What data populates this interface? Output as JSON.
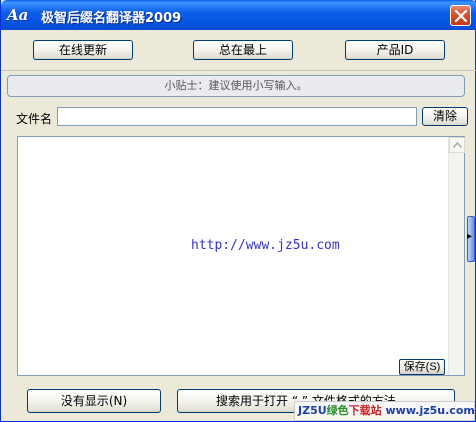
{
  "window": {
    "logo": "Aa",
    "title": "极智后缀名翻译器2009",
    "close_label": "close"
  },
  "toolbar": {
    "online_update": "在线更新",
    "always_on_top": "总在最上",
    "product_id": "产品ID"
  },
  "tip": "小贴士：建议使用小写输入。",
  "file": {
    "label": "文件名",
    "value": "",
    "clear": "清除"
  },
  "output": {
    "url": "http://www.jz5u.com",
    "save": "保存(S)"
  },
  "bottom": {
    "no_display": "没有显示(N)",
    "search_open": "搜索用于打开 “.”  文件格式的方法"
  },
  "watermark": {
    "part1": "JZ5U",
    "part2": "绿色",
    "part3": "下载站",
    "part4": "www.jz5u.com"
  }
}
